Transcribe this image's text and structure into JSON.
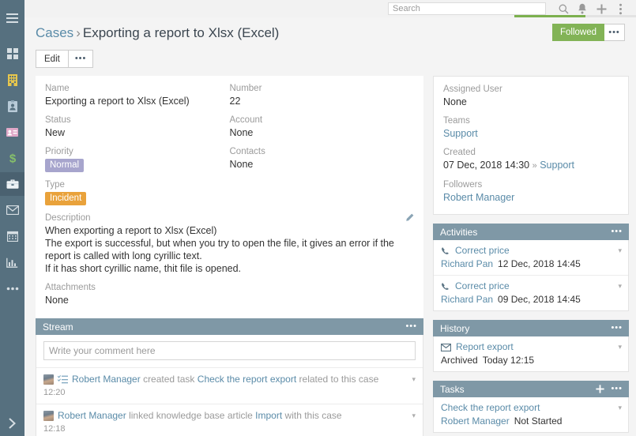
{
  "rail": {
    "items": [
      {
        "icon": "hamburger-icon",
        "name": "menu-toggle"
      },
      {
        "icon": "grid-icon",
        "name": "dashboard"
      },
      {
        "icon": "building-icon",
        "name": "accounts"
      },
      {
        "icon": "contact-card-icon",
        "name": "contacts"
      },
      {
        "icon": "id-card-icon",
        "name": "leads"
      },
      {
        "icon": "dollar-icon",
        "name": "opportunities"
      },
      {
        "icon": "briefcase-icon",
        "name": "cases"
      },
      {
        "icon": "envelope-icon",
        "name": "email"
      },
      {
        "icon": "calendar-icon",
        "name": "calendar"
      },
      {
        "icon": "chart-icon",
        "name": "reports"
      },
      {
        "icon": "ellipsis-icon",
        "name": "more"
      }
    ],
    "expand_icon": "chevron-right-icon"
  },
  "topbar": {
    "search_placeholder": "Search",
    "search_value": "",
    "icons": [
      "search-icon",
      "bell-icon",
      "plus-icon",
      "kebab-icon"
    ]
  },
  "header": {
    "breadcrumb_root": "Cases",
    "breadcrumb_sep": "›",
    "title": "Exporting a report to Xlsx (Excel)",
    "follow_label": "Followed",
    "follow_color": "#82b356",
    "edit_label": "Edit"
  },
  "detail": {
    "left": [
      {
        "label": "Name",
        "value": "Exporting a report to Xlsx (Excel)",
        "type": "text"
      },
      {
        "label": "Status",
        "value": "New",
        "type": "text"
      },
      {
        "label": "Priority",
        "value": "Normal",
        "type": "badge",
        "color": "#a7a5cd"
      },
      {
        "label": "Type",
        "value": "Incident",
        "type": "badge",
        "color": "#e9a23b"
      }
    ],
    "right": [
      {
        "label": "Number",
        "value": "22"
      },
      {
        "label": "Account",
        "value": "None"
      },
      {
        "label": "Contacts",
        "value": "None"
      }
    ],
    "description_label": "Description",
    "description_lines": [
      "When exporting a report to Xlsx (Excel)",
      "The export is successful, but when you try to open the file, it gives an error if the report is called with long cyrillic text.",
      "If it has short cyrillic name, thit file is opened."
    ],
    "attachments_label": "Attachments",
    "attachments_value": "None",
    "edit_icon": "pencil-icon"
  },
  "stream": {
    "title": "Stream",
    "menu_icon": "ellipsis-icon",
    "comment_placeholder": "Write your comment here",
    "comment_value": "",
    "posts": [
      {
        "author": "Robert Manager",
        "action_before": "created task",
        "link": "Check the report export",
        "action_after": "related to this case",
        "time": "12:20",
        "has_task_icon": true,
        "task_icon": "task-list-icon"
      },
      {
        "author": "Robert Manager",
        "action_before": "linked knowledge base article",
        "link": "Import",
        "action_after": "with this case",
        "time": "12:18",
        "has_task_icon": false,
        "task_icon": ""
      }
    ]
  },
  "side": {
    "fields": [
      {
        "label": "Assigned User",
        "value": "None",
        "link": false
      },
      {
        "label": "Teams",
        "value": "Support",
        "link": true
      },
      {
        "label": "Created",
        "value": "07 Dec, 2018 14:30",
        "suffix_sep": "»",
        "suffix": "Support",
        "link": false
      },
      {
        "label": "Followers",
        "value": "Robert Manager",
        "link": true
      }
    ],
    "activities": {
      "title": "Activities",
      "menu_icon": "ellipsis-icon",
      "items": [
        {
          "icon": "phone-icon",
          "title": "Correct price",
          "person": "Richard Pan",
          "meta": "12 Dec, 2018 14:45"
        },
        {
          "icon": "phone-icon",
          "title": "Correct price",
          "person": "Richard Pan",
          "meta": "09 Dec, 2018 14:45"
        }
      ]
    },
    "history": {
      "title": "History",
      "menu_icon": "ellipsis-icon",
      "items": [
        {
          "icon": "envelope-icon",
          "title": "Report export",
          "person": "Archived",
          "meta": "Today 12:15"
        }
      ]
    },
    "tasks": {
      "title": "Tasks",
      "add_icon": "plus-icon",
      "menu_icon": "ellipsis-icon",
      "items": [
        {
          "icon": "",
          "title": "Check the report export",
          "person": "Robert Manager",
          "meta": "Not Started"
        }
      ]
    }
  }
}
